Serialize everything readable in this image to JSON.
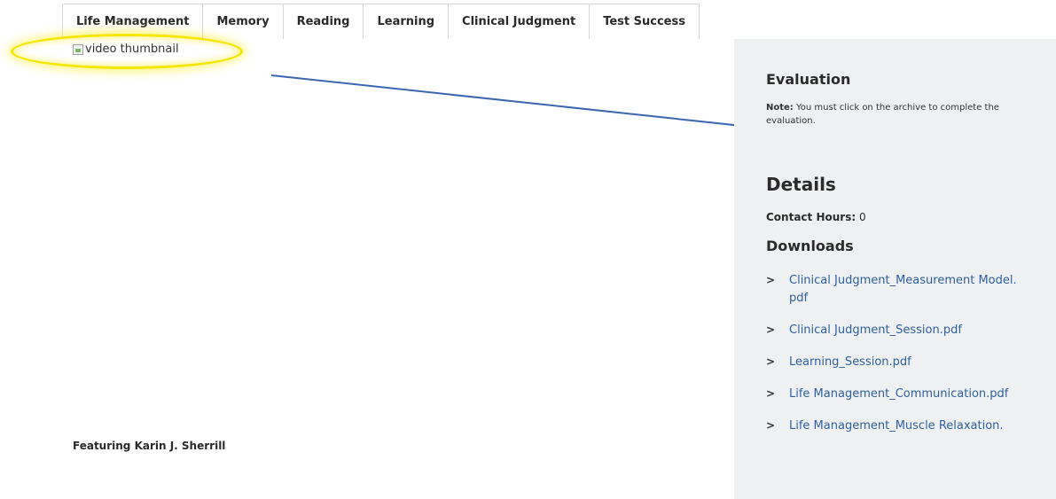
{
  "tabs": [
    {
      "label": "Life Management"
    },
    {
      "label": "Memory"
    },
    {
      "label": "Reading"
    },
    {
      "label": "Learning"
    },
    {
      "label": "Clinical Judgment"
    },
    {
      "label": "Test Success"
    }
  ],
  "video": {
    "alt_text": "video thumbnail"
  },
  "featuring": "Featuring Karin J. Sherrill",
  "sidebar": {
    "evaluation_title": "Evaluation",
    "note_label": "Note:",
    "note_text": " You must click on the archive to complete the evaluation.",
    "details_title": "Details",
    "contact_label": "Contact Hours:",
    "contact_value": " 0",
    "downloads_title": "Downloads",
    "downloads": [
      {
        "label": "Clinical Judgment_Measurement Model.pdf"
      },
      {
        "label": "Clinical Judgment_Session.pdf"
      },
      {
        "label": "Learning_Session.pdf"
      },
      {
        "label": "Life Management_Communication.pdf"
      },
      {
        "label": "Life Management_Muscle Relaxation."
      }
    ]
  },
  "colors": {
    "highlight": "#f5e600",
    "annotation_line": "#3b66b0",
    "link": "#2f5fa0",
    "sidebar_bg": "#eff0f1"
  },
  "icons": {
    "chevron": "chevron-right-icon",
    "broken_image": "broken-image-icon"
  }
}
